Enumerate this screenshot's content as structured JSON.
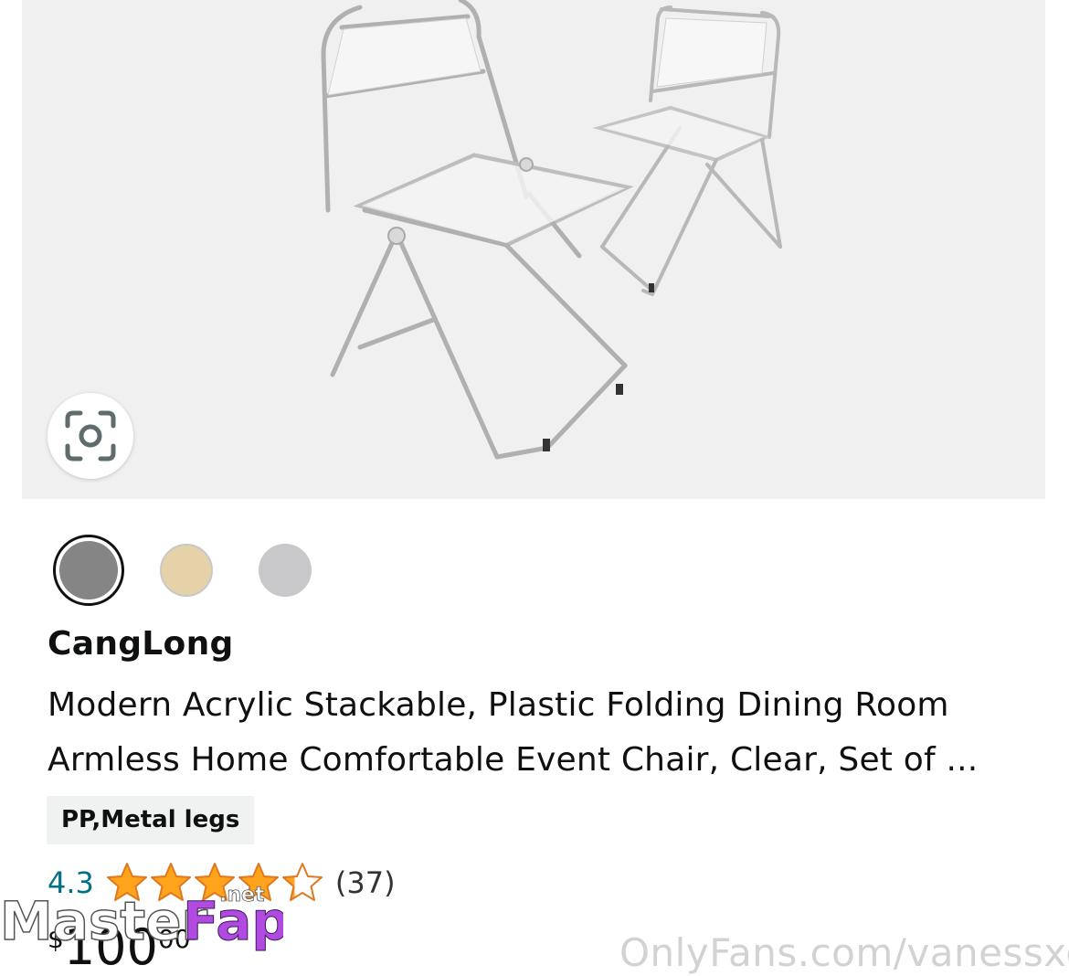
{
  "product": {
    "brand": "CangLong",
    "title_line1": "Modern Acrylic Stackable, Plastic Folding Dining Room",
    "title_line2": "Armless Home Comfortable Event Chair, Clear, Set of ...",
    "feature_chip": "PP,Metal legs",
    "rating": "4.3",
    "stars": 4.3,
    "review_count": "(37)",
    "price_symbol": "$",
    "price_whole": "100",
    "price_fraction": "00"
  },
  "swatches": [
    {
      "name": "gray",
      "color": "#858585",
      "selected": true
    },
    {
      "name": "beige",
      "color": "#e6d2a8",
      "selected": false
    },
    {
      "name": "silver",
      "color": "#c9c9cc",
      "selected": false
    }
  ],
  "icons": {
    "lens": "camera-search-icon",
    "star": "star-icon"
  },
  "colors": {
    "link": "#007185",
    "star": "#ffa41c",
    "image_bg": "#f0f0f0"
  },
  "watermarks": {
    "left_main": "Master",
    "left_accent": "Fap",
    "left_suffix": ".net",
    "right": "OnlyFans.com/vanessxo"
  }
}
